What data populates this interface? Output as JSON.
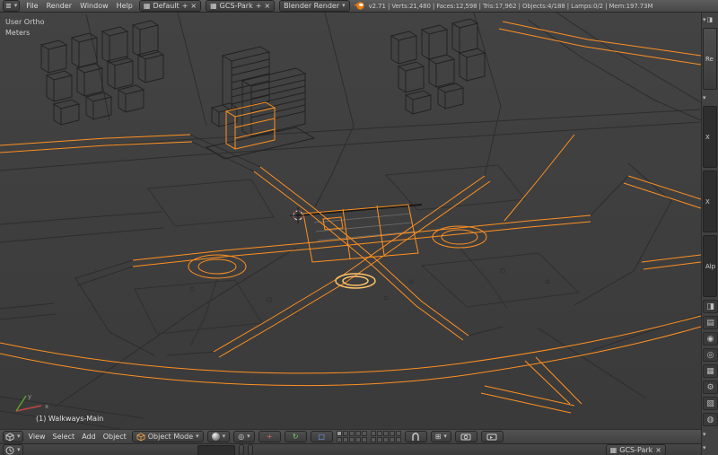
{
  "colors": {
    "select_orange": "#ff9021",
    "active_orange": "#ffc46b",
    "viewport_bg": "#3f3f3f",
    "header_bg": "#4c4c4c",
    "wire_dark": "#242424"
  },
  "icons": {
    "chevron_down": "▾",
    "close": "×",
    "plus": "+",
    "menu": "≣",
    "grid": "▦",
    "pivot": "◎",
    "snap_element": "⊞",
    "translate": "+",
    "rotate": "↻",
    "scale": "□",
    "rail_render": "◨",
    "rail_layers": "▤",
    "rail_scene": "◉",
    "rail_world": "◎",
    "rail_object": "▦",
    "rail_modifiers": "⚙",
    "rail_data": "▧",
    "rail_material": "◍"
  },
  "top_bar": {
    "menus": [
      "File",
      "Render",
      "Window",
      "Help"
    ],
    "layout_name": "Default",
    "scene_name": "GCS-Park",
    "engine_name": "Blender Render",
    "stats": "v2.71 | Verts:21,480 | Faces:12,598 | Tris:17,962 | Objects:4/188 | Lamps:0/2 | Mem:197.73M"
  },
  "viewport": {
    "view_label": "User Ortho",
    "units_label": "Meters",
    "active_object": "(1) Walkways-Main",
    "axis_x": "x",
    "axis_y": "y"
  },
  "view3d_header": {
    "menus": [
      "View",
      "Select",
      "Add",
      "Object"
    ],
    "mode_label": "Object Mode"
  },
  "bottom_bar": {
    "scene_datablock": "GCS-Park"
  },
  "properties_rail": {
    "fragments": [
      "Re",
      "X",
      "X",
      "Alp"
    ]
  }
}
